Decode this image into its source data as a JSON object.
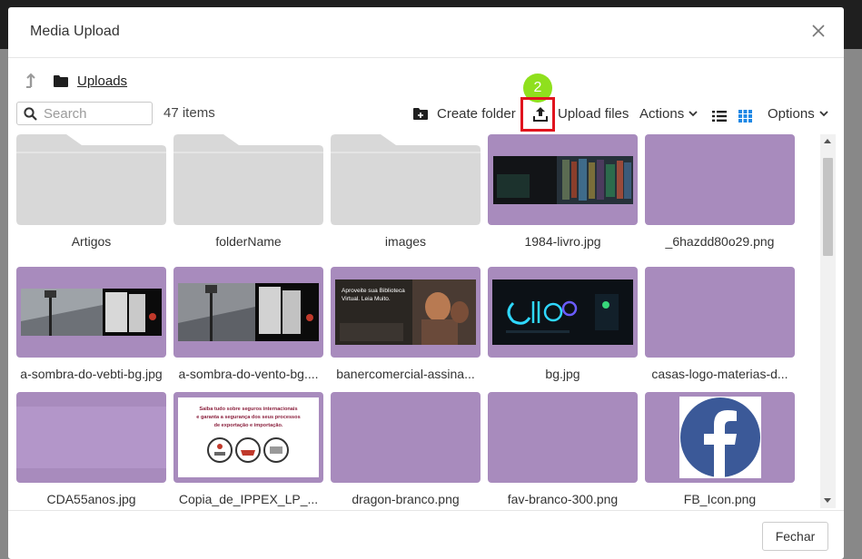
{
  "modal": {
    "title": "Media Upload",
    "footer_close": "Fechar"
  },
  "breadcrumb": {
    "current": "Uploads"
  },
  "toolbar": {
    "search_placeholder": "Search",
    "item_count": "47 items",
    "create_folder": "Create folder",
    "upload_files": "Upload files",
    "actions": "Actions",
    "options": "Options",
    "step_badge": "2"
  },
  "colors": {
    "thumb_background": "#a88bbd",
    "highlight": "#e0141e",
    "badge": "#8fe01d",
    "grid_view_active": "#1e88e5"
  },
  "items": [
    {
      "name": "Artigos",
      "kind": "folder"
    },
    {
      "name": "folderName",
      "kind": "folder"
    },
    {
      "name": "images",
      "kind": "folder"
    },
    {
      "name": "1984-livro.jpg",
      "kind": "image",
      "preview": "dark-bookshelf-banner"
    },
    {
      "name": "_6hazdd80o29.png",
      "kind": "image",
      "preview": "blank"
    },
    {
      "name": "a-sombra-do-vebti-bg.jpg",
      "kind": "image",
      "preview": "street-lamp-banner"
    },
    {
      "name": "a-sombra-do-vento-bg....",
      "kind": "image",
      "preview": "street-lamp-banner"
    },
    {
      "name": "banercomercial-assina...",
      "kind": "image",
      "preview": "reading-couple-banner"
    },
    {
      "name": "bg.jpg",
      "kind": "image",
      "preview": "neon-banner"
    },
    {
      "name": "casas-logo-materias-d...",
      "kind": "image",
      "preview": "blank"
    },
    {
      "name": "CDA55anos.jpg",
      "kind": "image",
      "preview": "light-purple-banner"
    },
    {
      "name": "Copia_de_IPPEX_LP_...",
      "kind": "image",
      "preview": "insurance-flyer"
    },
    {
      "name": "dragon-branco.png",
      "kind": "image",
      "preview": "blank"
    },
    {
      "name": "fav-branco-300.png",
      "kind": "image",
      "preview": "blank"
    },
    {
      "name": "FB_Icon.png",
      "kind": "image",
      "preview": "facebook-logo"
    }
  ],
  "thumb_text": {
    "banner_line1": "Aproveite sua Biblioteca",
    "banner_line2": "Virtual. Leia Muito.",
    "flyer_line1": "Saiba tudo sobre seguros internacionais",
    "flyer_line2": "e garanta a segurança dos seus processos",
    "flyer_line3": "de exportação e importação."
  }
}
